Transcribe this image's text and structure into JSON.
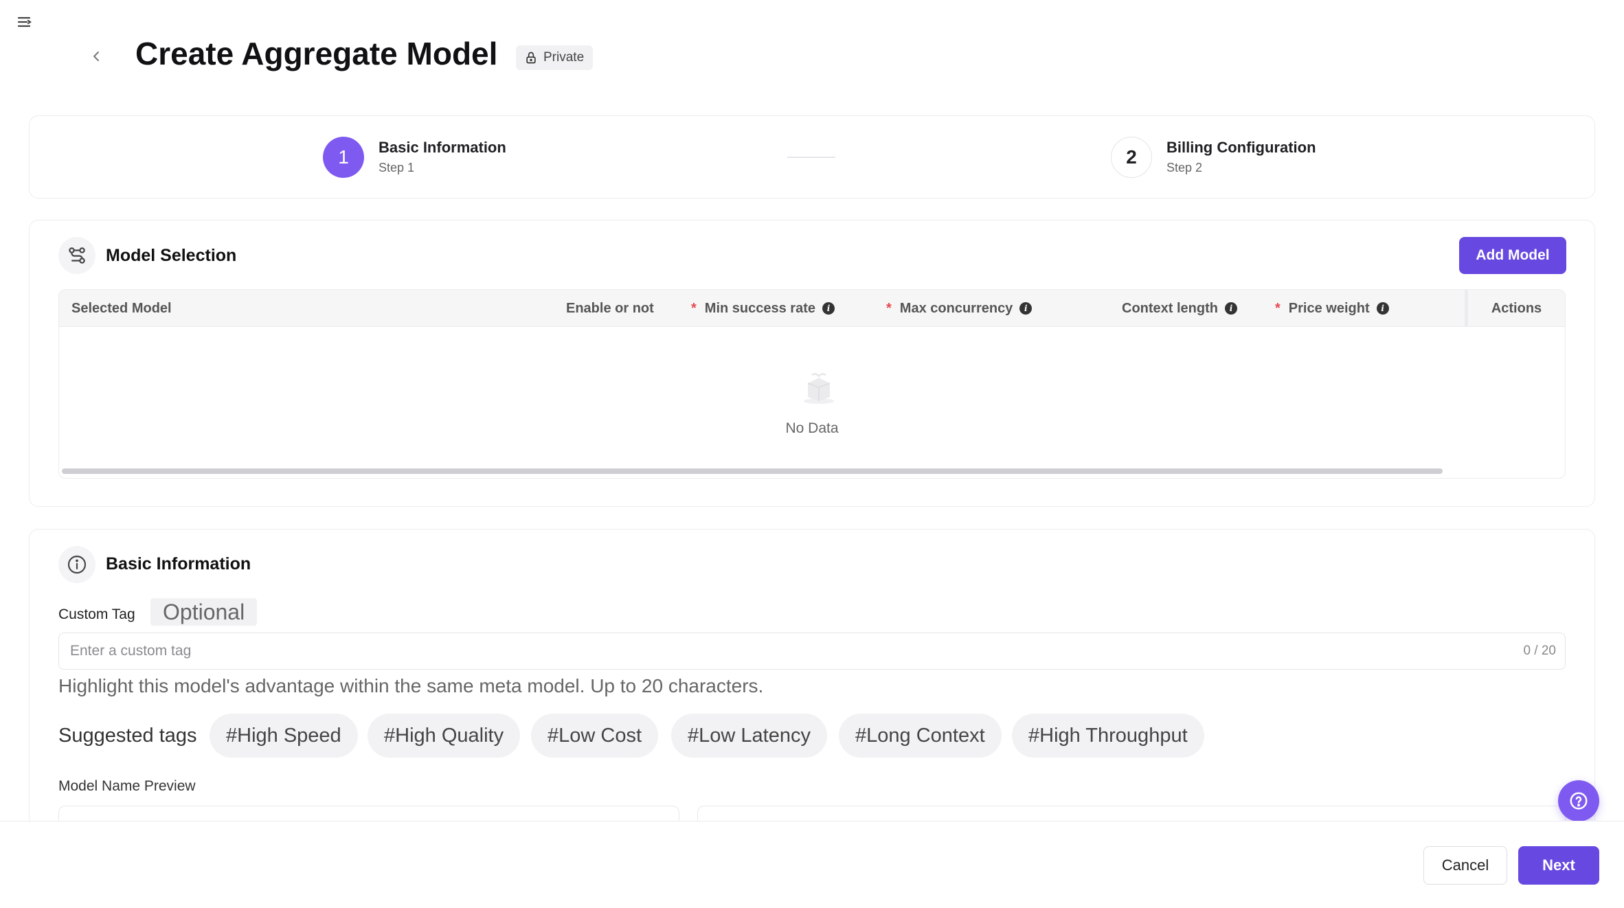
{
  "header": {
    "title": "Create Aggregate Model",
    "visibility": "Private"
  },
  "steps": [
    {
      "number": "1",
      "title": "Basic Information",
      "subtitle": "Step 1",
      "active": true
    },
    {
      "number": "2",
      "title": "Billing Configuration",
      "subtitle": "Step 2",
      "active": false
    }
  ],
  "model_selection": {
    "title": "Model Selection",
    "add_button": "Add Model",
    "columns": {
      "selected_model": "Selected Model",
      "enable": "Enable or not",
      "min_success_rate": "Min success rate",
      "max_concurrency": "Max concurrency",
      "context_length": "Context length",
      "price_weight": "Price weight",
      "actions": "Actions"
    },
    "required_mark": "*",
    "empty_text": "No Data"
  },
  "basic_info": {
    "title": "Basic Information",
    "custom_tag_label": "Custom Tag",
    "optional_label": "Optional",
    "custom_tag_placeholder": "Enter a custom tag",
    "char_count": "0 / 20",
    "help_text": "Highlight this model's advantage within the same meta model. Up to 20 characters.",
    "suggested_label": "Suggested tags",
    "suggested_tags": [
      "#High Speed",
      "#High Quality",
      "#Low Cost",
      "#Low Latency",
      "#Long Context",
      "#High Throughput"
    ],
    "preview_label": "Model Name Preview"
  },
  "footer": {
    "cancel": "Cancel",
    "next": "Next"
  },
  "colors": {
    "primary": "#6748e0",
    "step_active": "#7f5af0",
    "required": "#e5484d"
  },
  "icons": [
    "menu-icon",
    "chevron-left-icon",
    "lock-icon",
    "route-icon",
    "info-circle-icon",
    "empty-box-icon",
    "help-circle-icon"
  ]
}
